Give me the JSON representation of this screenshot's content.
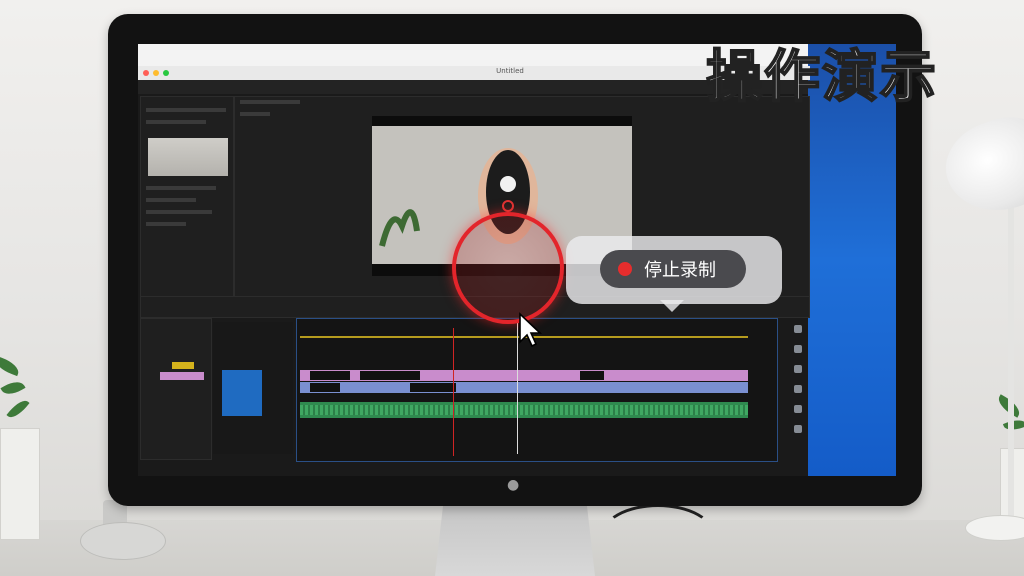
{
  "overlay": {
    "caption": "操作演示",
    "stop_recording_label": "停止录制"
  },
  "app": {
    "window_title": "Untitled"
  },
  "colors": {
    "record_red": "#e3252b",
    "timeline_pink": "#c98ccc",
    "timeline_blue": "#7a8fd1",
    "timeline_green": "#2f8a4f",
    "tool_accent": "#1f6bc1",
    "desktop_blue": "#1f6fd8"
  },
  "icons": [
    "apple-logo-icon",
    "record-dot-icon",
    "mouse-cursor-icon",
    "window-close-icon",
    "window-minimize-icon",
    "window-zoom-icon"
  ]
}
